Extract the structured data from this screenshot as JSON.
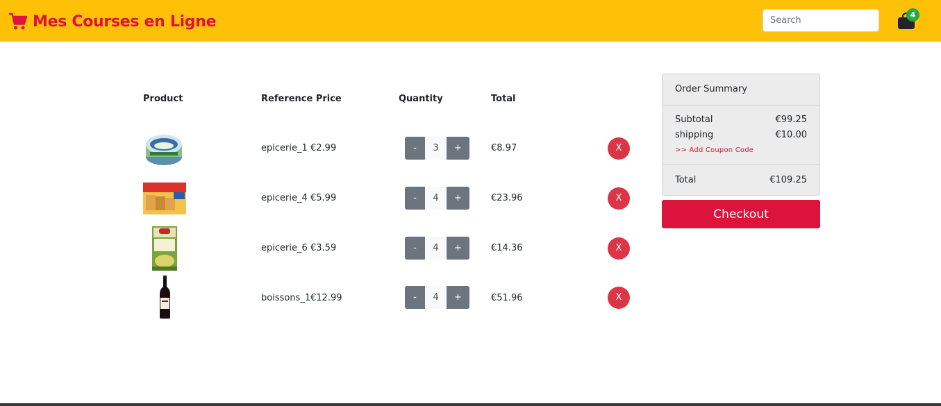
{
  "brand": {
    "name": "Mes Courses en Ligne",
    "icon": "shopping-cart-icon",
    "color": "#dc143c"
  },
  "navbar": {
    "background": "#ffc107"
  },
  "search": {
    "placeholder": "Search",
    "value": ""
  },
  "cart": {
    "icon": "shopping-bag-icon",
    "count": "4"
  },
  "table": {
    "headers": {
      "product": "Product",
      "reference_price": "Reference Price",
      "quantity": "Quantity",
      "total": "Total"
    },
    "rows": [
      {
        "product_image": "tuna-can-la-monegasque",
        "reference": "epicerie_1",
        "price": "€2.99",
        "minus": "-",
        "quantity": "3",
        "plus": "+",
        "total": "€8.97",
        "remove": "X"
      },
      {
        "product_image": "heudebert-rusks-box",
        "reference": "epicerie_4",
        "price": "€5.99",
        "minus": "-",
        "quantity": "4",
        "plus": "+",
        "total": "€23.96",
        "remove": "X"
      },
      {
        "product_image": "soup-carton",
        "reference": "epicerie_6",
        "price": "€3.59",
        "minus": "-",
        "quantity": "4",
        "plus": "+",
        "total": "€14.36",
        "remove": "X"
      },
      {
        "product_image": "red-wine-bottle",
        "reference": "boissons_1",
        "price": "€12.99",
        "minus": "-",
        "quantity": "4",
        "plus": "+",
        "total": "€51.96",
        "remove": "X"
      }
    ]
  },
  "summary": {
    "title": "Order Summary",
    "subtotal_label": "Subtotal",
    "subtotal_value": "€99.25",
    "shipping_label": "shipping",
    "shipping_value": "€10.00",
    "coupon_link": ">> Add Coupon Code",
    "total_label": "Total",
    "total_value": "€109.25",
    "checkout_label": "Checkout"
  },
  "colors": {
    "accent": "#dc143c",
    "remove": "#dc3545",
    "qty_button": "#6c757d",
    "badge": "#28a745"
  }
}
